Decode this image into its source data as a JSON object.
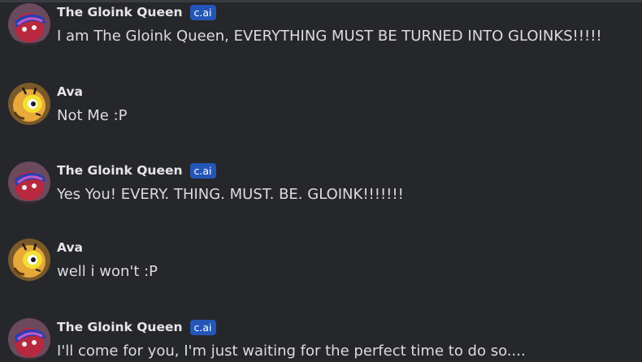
{
  "badge_label": "c.ai",
  "messages": [
    {
      "author": "The Gloink Queen",
      "is_ai": true,
      "text": "I am The Gloink Queen, EVERYTHING MUST BE TURNED INTO GLOINKS!!!!!"
    },
    {
      "author": "Ava",
      "is_ai": false,
      "text": "Not Me :P"
    },
    {
      "author": "The Gloink Queen",
      "is_ai": true,
      "text": "Yes You! EVERY. THING. MUST. BE. GLOINK!!!!!!!"
    },
    {
      "author": "Ava",
      "is_ai": false,
      "text": "well i won't :P"
    },
    {
      "author": "The Gloink Queen",
      "is_ai": true,
      "text": "I'll come for you, I'm just waiting for the perfect time to do so...."
    }
  ],
  "colors": {
    "background": "#26272b",
    "badge": "#2456b8",
    "name_text": "#e6e6ea",
    "message_text": "#dcdce0"
  },
  "icons": {
    "gloink_queen_avatar": "gloink-queen-avatar-icon",
    "ava_avatar": "ava-avatar-icon"
  }
}
